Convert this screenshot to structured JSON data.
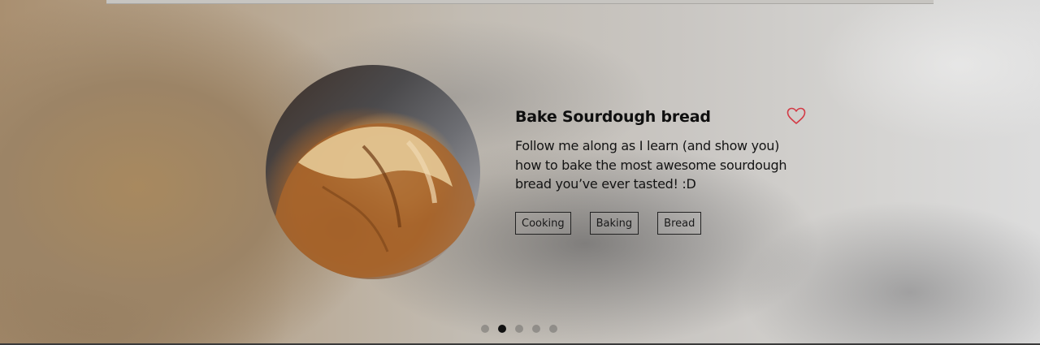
{
  "slide": {
    "title": "Bake Sourdough bread",
    "description": "Follow me along as I learn (and show you) how to bake the most awesome sourdough bread you’ve ever tasted! :D",
    "tags": [
      "Cooking",
      "Baking",
      "Bread"
    ],
    "favorite_icon": "heart-outline-icon",
    "favorite_color": "#d33a45",
    "image": "bread-photo"
  },
  "carousel": {
    "total": 5,
    "active_index": 1
  }
}
